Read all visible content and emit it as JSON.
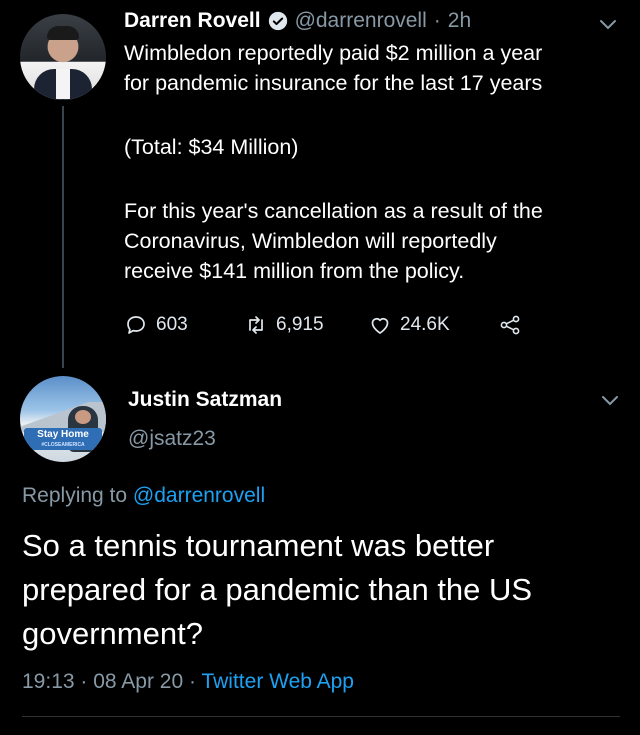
{
  "tweet1": {
    "name": "Darren Rovell",
    "handle": "@darrenrovell",
    "separator": "·",
    "time": "2h",
    "lines": [
      "Wimbledon reportedly paid $2 million a year",
      "for pandemic insurance for the last 17 years",
      "(Total: $34 Million)",
      "For this year's cancellation as a result of the",
      "Coronavirus, Wimbledon will reportedly",
      "receive $141 million from the policy."
    ],
    "replies": "603",
    "retweets": "6,915",
    "likes": "24.6K"
  },
  "tweet2": {
    "name": "Justin Satzman",
    "handle": "@jsatz23",
    "avatar_badge": "Stay Home",
    "avatar_badge_small": "#CLOSEAMERICA",
    "replying_prefix": "Replying to",
    "replying_to": "@darrenrovell",
    "lines": [
      "So a tennis tournament was better",
      "prepared for a pandemic than the US",
      "government?"
    ],
    "time": "19:13",
    "separator": "·",
    "date": "08 Apr 20",
    "app": "Twitter Web App"
  },
  "icons": {
    "reply": "reply-icon",
    "retweet": "retweet-icon",
    "like": "heart-icon",
    "share": "share-icon",
    "verified": "verified-badge-icon",
    "more": "chevron-down-icon"
  },
  "colors": {
    "background": "#000000",
    "text": "#ffffff",
    "secondary_text": "#8899a6",
    "link": "#1da1f2",
    "verified": "#1da1f2"
  }
}
